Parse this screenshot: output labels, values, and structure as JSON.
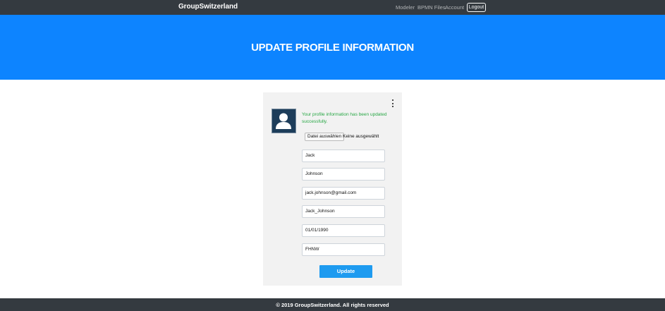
{
  "navbar": {
    "brand": "GroupSwitzerland",
    "links": [
      "Modeler",
      "BPMN Files",
      "Account"
    ],
    "logout_label": "Logout"
  },
  "hero": {
    "title": "UPDATE PROFILE INFORMATION"
  },
  "profile": {
    "avatar_icon": "user-silhouette-icon",
    "success_message": "Your profile information has been updated successfully.",
    "file_button_label": "Datei auswählen",
    "file_status": "Keine ausgewählt",
    "fields": {
      "first_name": "Jack",
      "last_name": "Johnson",
      "email": "jack.johnson@gmail.com",
      "username": "Jack_Johnson",
      "birthdate": "01/01/1990",
      "organization": "FHNW"
    },
    "update_label": "Update",
    "menu_icon": "kebab-menu-icon"
  },
  "footer": {
    "text": "© 2019 GroupSwitzerland. All rights reserved"
  },
  "colors": {
    "navbar_bg": "#343a40",
    "hero_bg": "#0d84ff",
    "success": "#28a745",
    "button": "#1e9bf0"
  }
}
